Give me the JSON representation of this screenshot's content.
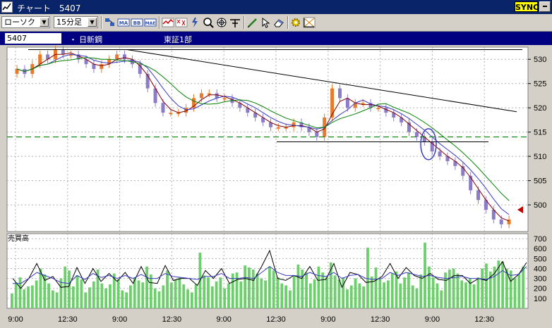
{
  "window": {
    "title": "チャート　5407",
    "sync_label": "SYNC"
  },
  "toolbar": {
    "chart_type": "ローソク",
    "interval": "15分足",
    "buttons": [
      "settings-icon",
      "ma-icon",
      "bb-icon",
      "mae-icon",
      "line-chart-icon",
      "point-figure-icon",
      "bolt-icon",
      "zoom-icon",
      "crosshair-icon",
      "pen-icon",
      "cursor-icon",
      "eraser-icon",
      "gear-icon",
      "fibonacci-icon"
    ],
    "labels": {
      "ma": "MA",
      "bb": "BB",
      "mae": "MAE"
    }
  },
  "info": {
    "code": "5407",
    "dot": "・",
    "name": "日新鋼",
    "market": "東証1部"
  },
  "colors": {
    "up": "#e87a2a",
    "down": "#8c7cc8",
    "ma_short": "#800000",
    "ma_mid": "#3b3bc0",
    "ma_long": "#008000",
    "volume": "#6ccf6c",
    "support": "#008000"
  },
  "chart_data": {
    "type": "candlestick",
    "price_axis": {
      "ticks": [
        530,
        525,
        520,
        515,
        510,
        505,
        500
      ],
      "ylim": [
        494.5,
        532.5
      ]
    },
    "time_axis": [
      "9:00",
      "12:30",
      "9:00",
      "12:30",
      "9:00",
      "12:30",
      "9:00",
      "12:30",
      "9:00",
      "12:30"
    ],
    "annotations": {
      "support_level": 514,
      "horizontal_resistance": 532,
      "support_segment": 513
    },
    "close_path": [
      528,
      527,
      529,
      531,
      530,
      532,
      531,
      531,
      530,
      529,
      528,
      529,
      530,
      531,
      530,
      529,
      527,
      524,
      521,
      519,
      519,
      519,
      520,
      522,
      523,
      523,
      522,
      522,
      521,
      520,
      519,
      518,
      517,
      516,
      516,
      516,
      517,
      516,
      515,
      514,
      518,
      524,
      522,
      520,
      521,
      521,
      520,
      520,
      519,
      518,
      517,
      515,
      514,
      513,
      511,
      510,
      509,
      508,
      506,
      503,
      501,
      499,
      497,
      496,
      497
    ],
    "volume": {
      "label": "売買高",
      "ticks": [
        700,
        600,
        500,
        400,
        300,
        200,
        100
      ],
      "ylim": [
        0,
        750
      ],
      "bars": [
        150,
        260,
        310,
        190,
        220,
        230,
        280,
        400,
        340,
        250,
        180,
        160,
        300,
        420,
        380,
        220,
        330,
        290,
        160,
        210,
        270,
        390,
        250,
        200,
        240,
        350,
        290,
        180,
        160,
        230,
        310,
        280,
        260,
        420,
        340,
        200,
        170,
        230,
        380,
        260,
        290,
        310,
        240,
        190,
        160,
        240,
        560,
        330,
        310,
        220,
        270,
        310,
        200,
        250,
        350,
        360,
        270,
        430,
        410,
        390,
        350,
        300,
        280,
        420,
        380,
        310,
        250,
        230,
        180,
        330,
        440,
        390,
        360,
        250,
        290,
        420,
        360,
        310,
        460,
        330,
        290,
        310,
        190,
        230,
        300,
        250,
        220,
        610,
        320,
        410,
        300,
        260,
        280,
        350,
        370,
        250,
        310,
        360,
        230,
        200,
        340,
        660,
        420,
        310,
        250,
        180,
        360,
        390,
        400,
        350,
        280,
        260,
        300,
        240,
        310,
        400,
        450,
        370,
        420,
        480,
        470,
        400,
        380,
        300,
        350,
        420
      ],
      "ma_line_a": [
        300,
        200,
        300,
        450,
        280,
        320,
        210,
        220,
        410,
        250,
        400,
        270,
        350,
        270,
        360,
        250,
        420,
        260,
        250,
        430,
        280,
        300,
        300,
        230,
        380,
        300,
        400,
        250,
        290,
        300,
        280,
        420,
        580,
        300,
        280,
        330,
        300,
        420,
        280,
        290,
        450,
        210,
        360,
        340,
        260,
        270,
        320,
        450,
        300,
        410,
        330,
        300,
        350,
        290,
        280,
        330,
        330,
        250,
        300,
        280,
        350,
        470,
        270,
        340,
        460
      ],
      "ma_line_b": [
        250,
        250,
        300,
        360,
        330,
        300,
        260,
        250,
        330,
        290,
        350,
        310,
        330,
        300,
        330,
        300,
        340,
        300,
        300,
        350,
        320,
        310,
        300,
        290,
        320,
        320,
        350,
        300,
        300,
        310,
        300,
        360,
        420,
        360,
        330,
        330,
        320,
        360,
        330,
        320,
        360,
        300,
        330,
        340,
        300,
        290,
        300,
        360,
        330,
        360,
        340,
        320,
        330,
        310,
        300,
        310,
        320,
        300,
        300,
        290,
        320,
        380,
        330,
        340,
        420
      ]
    }
  }
}
